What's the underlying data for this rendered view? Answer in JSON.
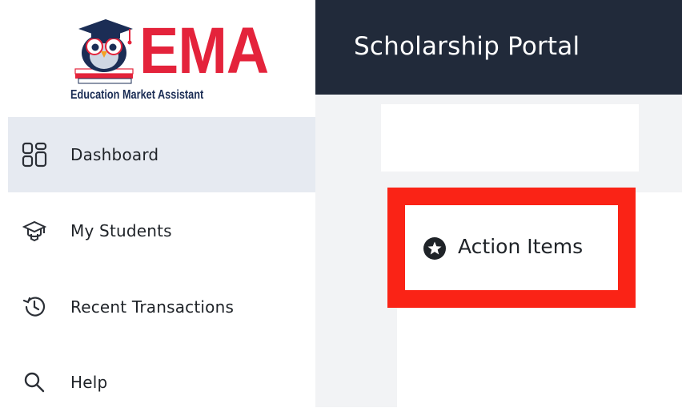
{
  "logo": {
    "brand": "EMA",
    "subtitle": "Education Market Assistant",
    "icon": "owl-graduate-logo-icon"
  },
  "sidebar": {
    "items": [
      {
        "label": "Dashboard",
        "icon": "dashboard-grid-icon",
        "active": true
      },
      {
        "label": "My Students",
        "icon": "graduation-cap-icon",
        "active": false
      },
      {
        "label": "Recent Transactions",
        "icon": "history-clock-icon",
        "active": false
      },
      {
        "label": "Help",
        "icon": "search-icon",
        "active": false
      }
    ]
  },
  "header": {
    "title": "Scholarship Portal"
  },
  "main": {
    "action_items": {
      "label": "Action Items",
      "icon": "star-circle-icon"
    }
  },
  "colors": {
    "header_bg": "#212a3a",
    "active_nav_bg": "#e6eaf1",
    "brand_red": "#e4233b",
    "brand_navy": "#1b2d55",
    "highlight_red": "#fa2316",
    "content_bg": "#f2f3f5"
  }
}
